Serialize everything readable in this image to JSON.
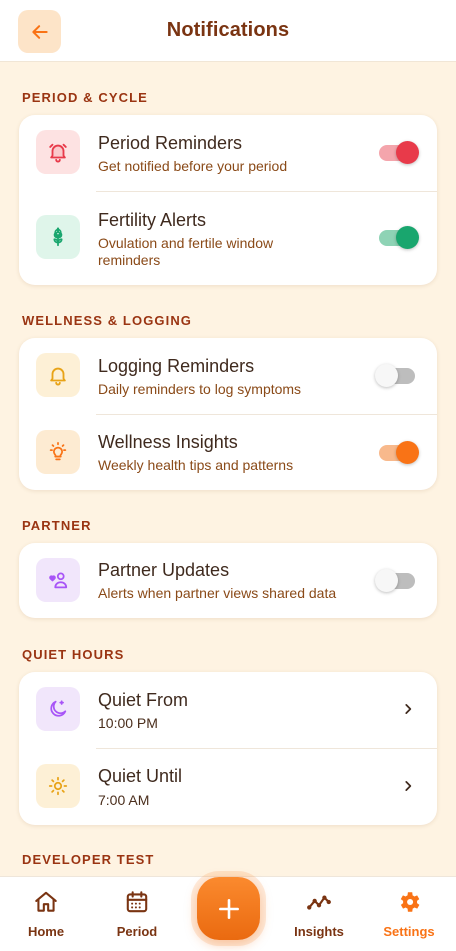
{
  "header": {
    "title": "Notifications"
  },
  "sections": {
    "period": {
      "label": "PERIOD & CYCLE",
      "items": [
        {
          "title": "Period Reminders",
          "subtitle": "Get notified before your period",
          "enabled": true,
          "toggle_color": "#E83A4A",
          "icon_bg": "#FDE2E2",
          "icon_color": "#E83A4A"
        },
        {
          "title": "Fertility Alerts",
          "subtitle": "Ovulation and fertile window reminders",
          "enabled": true,
          "toggle_color": "#19A66E",
          "icon_bg": "#DFF5EA",
          "icon_color": "#19A66E"
        }
      ]
    },
    "wellness": {
      "label": "WELLNESS & LOGGING",
      "items": [
        {
          "title": "Logging Reminders",
          "subtitle": "Daily reminders to log symptoms",
          "enabled": false,
          "icon_bg": "#FDF0D6",
          "icon_color": "#E8A317"
        },
        {
          "title": "Wellness Insights",
          "subtitle": "Weekly health tips and patterns",
          "enabled": true,
          "toggle_color": "#F97316",
          "icon_bg": "#FDEBD2",
          "icon_color": "#F97316"
        }
      ]
    },
    "partner": {
      "label": "PARTNER",
      "items": [
        {
          "title": "Partner Updates",
          "subtitle": "Alerts when partner views shared data",
          "enabled": false,
          "icon_bg": "#F1E6FB",
          "icon_color": "#A855F7"
        }
      ]
    },
    "quiet": {
      "label": "QUIET HOURS",
      "items": [
        {
          "title": "Quiet From",
          "value": "10:00 PM",
          "icon_bg": "#F1E6FB",
          "icon_color": "#A855F7"
        },
        {
          "title": "Quiet Until",
          "value": "7:00 AM",
          "icon_bg": "#FDF0D6",
          "icon_color": "#E8A317"
        }
      ]
    },
    "developer": {
      "label": "DEVELOPER TEST"
    }
  },
  "nav": {
    "home": "Home",
    "period": "Period",
    "insights": "Insights",
    "settings": "Settings",
    "active": "settings"
  },
  "colors": {
    "accent": "#F97316",
    "brown": "#7A3412",
    "background": "#FEF3E2"
  }
}
